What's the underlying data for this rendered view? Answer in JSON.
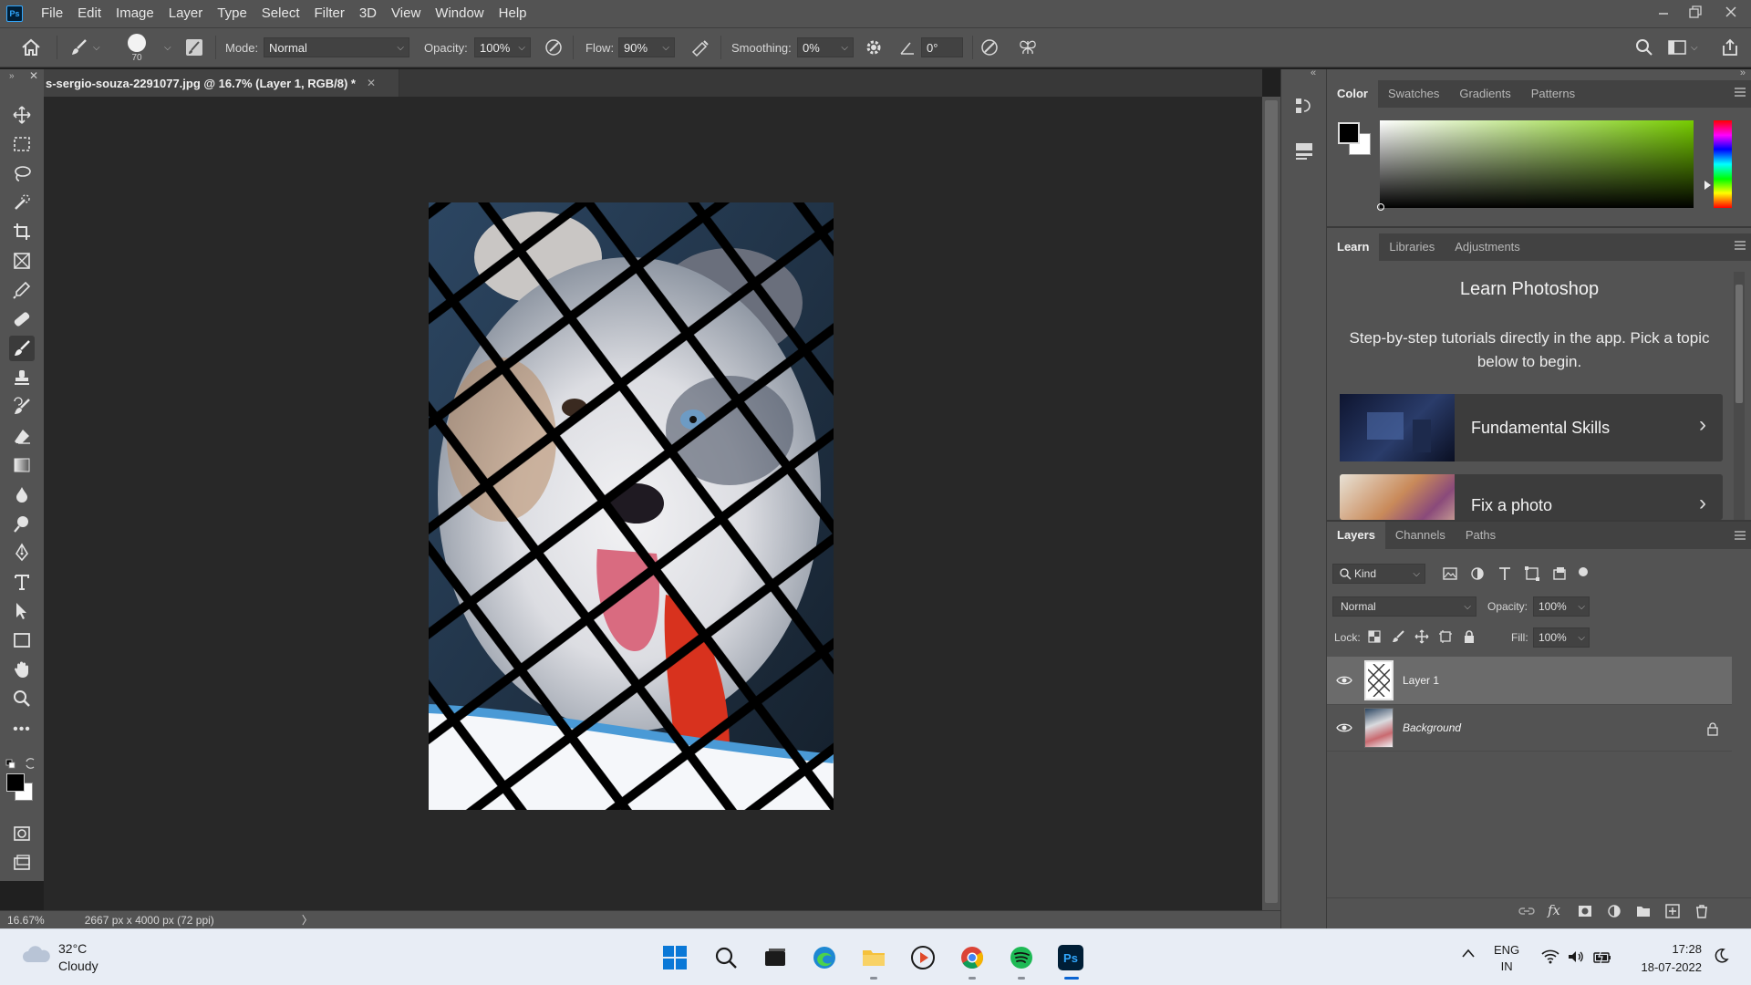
{
  "app": {
    "logo": "Ps",
    "menu": [
      "File",
      "Edit",
      "Image",
      "Layer",
      "Type",
      "Select",
      "Filter",
      "3D",
      "View",
      "Window",
      "Help"
    ]
  },
  "options_bar": {
    "brush_size": "70",
    "mode_label": "Mode:",
    "mode_value": "Normal",
    "opacity_label": "Opacity:",
    "opacity_value": "100%",
    "flow_label": "Flow:",
    "flow_value": "90%",
    "smoothing_label": "Smoothing:",
    "smoothing_value": "0%",
    "angle_value": "0°"
  },
  "document": {
    "tab_title": "s-sergio-souza-2291077.jpg @ 16.7% (Layer 1, RGB/8) *",
    "zoom": "16.67%",
    "dimensions": "2667 px x 4000 px (72 ppi)"
  },
  "color_panel": {
    "tabs": [
      "Color",
      "Swatches",
      "Gradients",
      "Patterns"
    ],
    "active_tab": "Color",
    "foreground": "#000000",
    "background": "#ffffff",
    "picker_hue": "#77cc00"
  },
  "learn_panel": {
    "tabs": [
      "Learn",
      "Libraries",
      "Adjustments"
    ],
    "title": "Learn Photoshop",
    "subtitle": "Step-by-step tutorials directly in the app. Pick a topic below to begin.",
    "cards": [
      {
        "label": "Fundamental Skills",
        "thumb": "dark-room"
      },
      {
        "label": "Fix a photo",
        "thumb": "flowers"
      }
    ]
  },
  "layers_panel": {
    "tabs": [
      "Layers",
      "Channels",
      "Paths"
    ],
    "filter_kind": "Kind",
    "blend_mode": "Normal",
    "opacity_label": "Opacity:",
    "opacity_value": "100%",
    "lock_label": "Lock:",
    "fill_label": "Fill:",
    "fill_value": "100%",
    "layers": [
      {
        "name": "Layer 1",
        "visible": true,
        "selected": true,
        "locked": false
      },
      {
        "name": "Background",
        "visible": true,
        "selected": false,
        "locked": true
      }
    ]
  },
  "taskbar": {
    "weather_temp": "32°C",
    "weather_desc": "Cloudy",
    "lang_top": "ENG",
    "lang_bottom": "IN",
    "time": "17:28",
    "date": "18-07-2022",
    "ps_label": "Ps"
  }
}
